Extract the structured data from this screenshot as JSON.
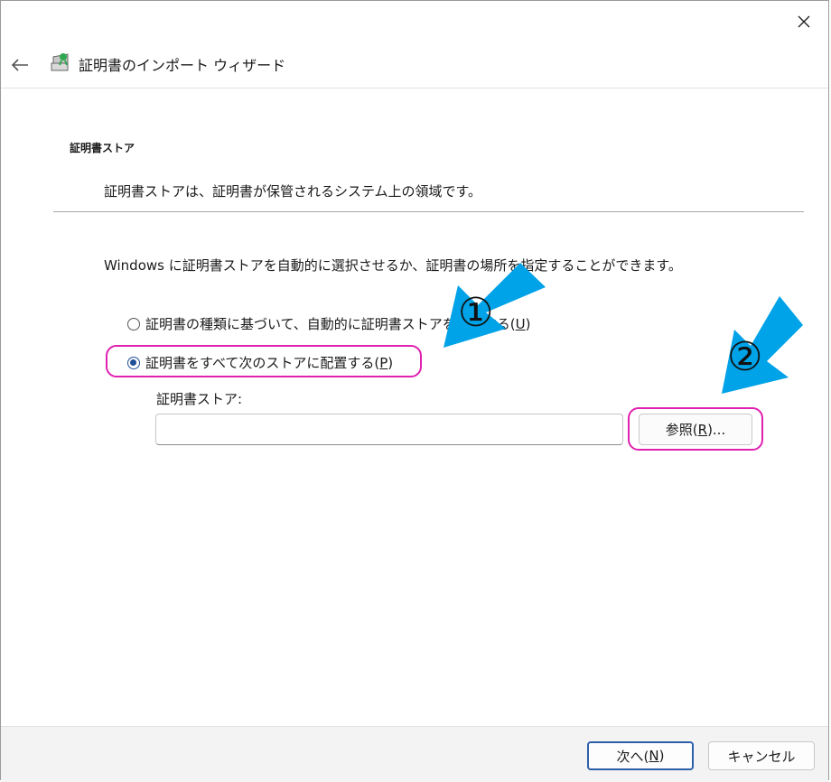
{
  "window": {
    "wizard_title": "証明書のインポート ウィザード"
  },
  "page": {
    "section_title": "証明書ストア",
    "section_description": "証明書ストアは、証明書が保管されるシステム上の領域です。",
    "instruction": "Windows に証明書ストアを自動的に選択させるか、証明書の場所を指定することができます。"
  },
  "options": [
    {
      "label_before": "証明書の種類に基づいて、自動的に証明書ストアを選択する(",
      "mnemonic": "U",
      "label_after": ")",
      "selected": false
    },
    {
      "label_before": "証明書をすべて次のストアに配置する(",
      "mnemonic": "P",
      "label_after": ")",
      "selected": true
    }
  ],
  "store": {
    "label": "証明書ストア:",
    "value": "",
    "browse_before": "参照(",
    "browse_mnemonic": "R",
    "browse_after": ")..."
  },
  "footer": {
    "next_before": "次へ(",
    "next_mnemonic": "N",
    "next_after": ")",
    "cancel_label": "キャンセル"
  },
  "annotations": {
    "marker_1": "①",
    "marker_2": "②",
    "arrow_color": "#00a2e8",
    "highlight_color": "#e020b0"
  },
  "icons": {
    "close": "close-icon",
    "back": "back-arrow-icon",
    "wizard": "certificate-wizard-icon"
  }
}
